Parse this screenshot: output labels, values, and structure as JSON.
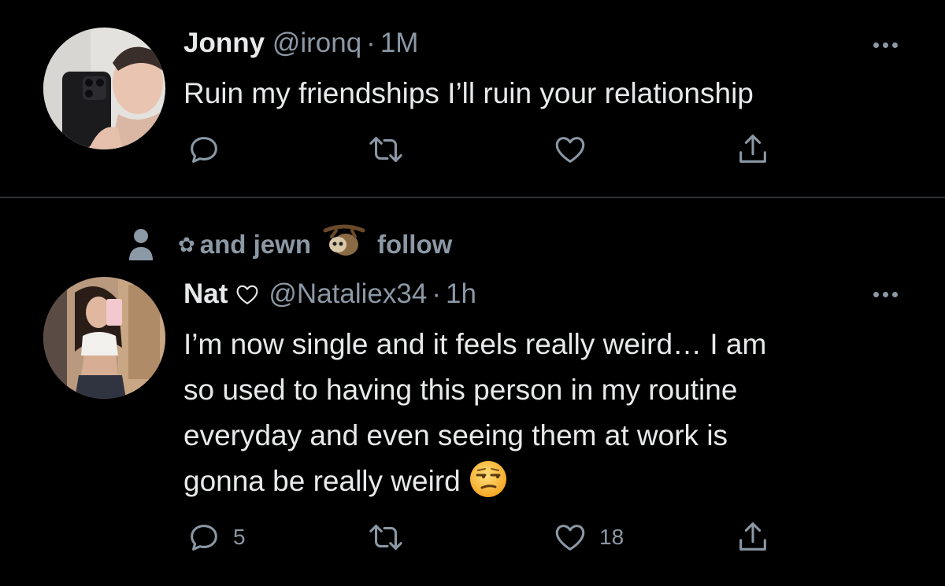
{
  "tweets": [
    {
      "author": {
        "name": "Jonny",
        "handle": "@ironq",
        "time": "1M",
        "avatar_icon": "avatar-selfie-phone"
      },
      "text": "Ruin my friendships I’ll ruin your relationship",
      "actions": {
        "reply_count": "",
        "retweet_count": "",
        "like_count": ""
      }
    },
    {
      "social_context": {
        "text": "and jewn",
        "suffix": "follow",
        "icons": [
          "person-icon",
          "flower-icon",
          "sloth-emoji"
        ]
      },
      "author": {
        "name": "Nat",
        "handle": "@Nataliex34",
        "time": "1h",
        "avatar_icon": "avatar-mirror-selfie",
        "name_badge": "heart-outline"
      },
      "text_lines": [
        "I’m now single and it feels really weird… I am",
        "so used to having this person in my routine",
        "everyday and even seeing them at work is",
        "gonna be really weird"
      ],
      "trailing_emoji": "unamused-face",
      "actions": {
        "reply_count": "5",
        "retweet_count": "",
        "like_count": "18"
      }
    }
  ],
  "colors": {
    "background": "#000000",
    "text": "#e7e9ea",
    "muted": "#8b98a5",
    "divider": "#2f3336"
  }
}
